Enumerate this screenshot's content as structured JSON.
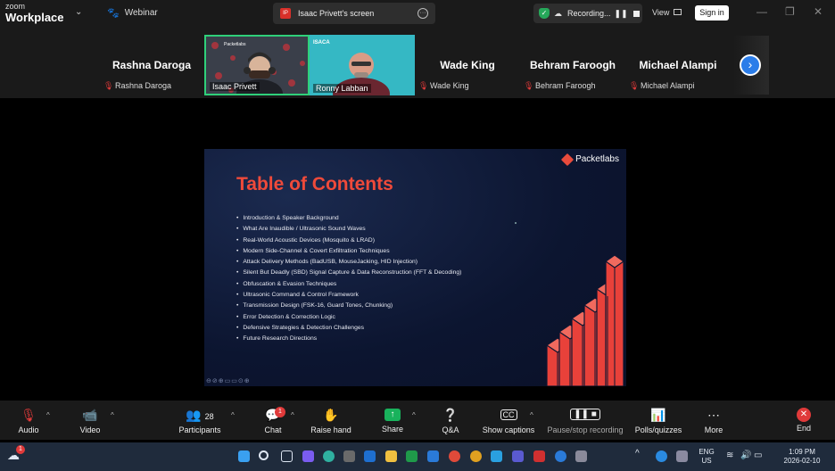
{
  "app": {
    "brand_line1": "zoom",
    "brand_line2": "Workplace",
    "webinar_label": "Webinar"
  },
  "share_tab": {
    "icon_text": "IP",
    "label": "Isaac Privett's screen"
  },
  "recording": {
    "label": "Recording...",
    "pause_glyph": "❚❚"
  },
  "header": {
    "view_label": "View",
    "signin_label": "Sign in"
  },
  "gallery": {
    "rashna": {
      "name": "Rashna Daroga",
      "tag": "Rashna Daroga"
    },
    "isaac": {
      "tag": "Isaac Privett"
    },
    "ronny": {
      "tag": "Ronny Labban"
    },
    "wade": {
      "name": "Wade King",
      "tag": "Wade King"
    },
    "behram": {
      "name": "Behram Faroogh",
      "tag": "Behram Faroogh"
    },
    "michael": {
      "name": "Michael Alampi",
      "tag": "Michael Alampi"
    }
  },
  "slide": {
    "logo_text": "Packetlabs",
    "title": "Table of Contents",
    "items": [
      "Introduction & Speaker Background",
      "What Are Inaudible / Ultrasonic Sound Waves",
      "Real-World Acoustic Devices (Mosquito & LRAD)",
      "Modern Side-Channel & Covert Exfiltration Techniques",
      "Attack Delivery Methods (BadUSB, MouseJacking, HID Injection)",
      "Silent But Deadly (SBD) Signal Capture & Data Reconstruction (FFT & Decoding)",
      "Obfuscation & Evasion Techniques",
      "Ultrasonic Command & Control Framework",
      "Transmission Design (FSK-16, Guard Tones, Chunking)",
      "Error Detection & Correction Logic",
      "Defensive Strategies & Detection Challenges",
      "Future Research Directions"
    ]
  },
  "toolbar": {
    "audio": "Audio",
    "video": "Video",
    "participants": "Participants",
    "participants_count": "28",
    "chat": "Chat",
    "chat_badge": "1",
    "raise_hand": "Raise hand",
    "share": "Share",
    "qa": "Q&A",
    "captions": "Show captions",
    "pause_recording": "Pause/stop recording",
    "polls": "Polls/quizzes",
    "more": "More",
    "end": "End"
  },
  "taskbar": {
    "weather_badge": "1",
    "lang_line1": "ENG",
    "lang_line2": "US",
    "time": "1:09 PM",
    "date": "2026-02-10"
  },
  "colors": {
    "accent_red": "#ef4a3a",
    "zoom_blue": "#2b7de9",
    "share_green": "#19b25c"
  }
}
